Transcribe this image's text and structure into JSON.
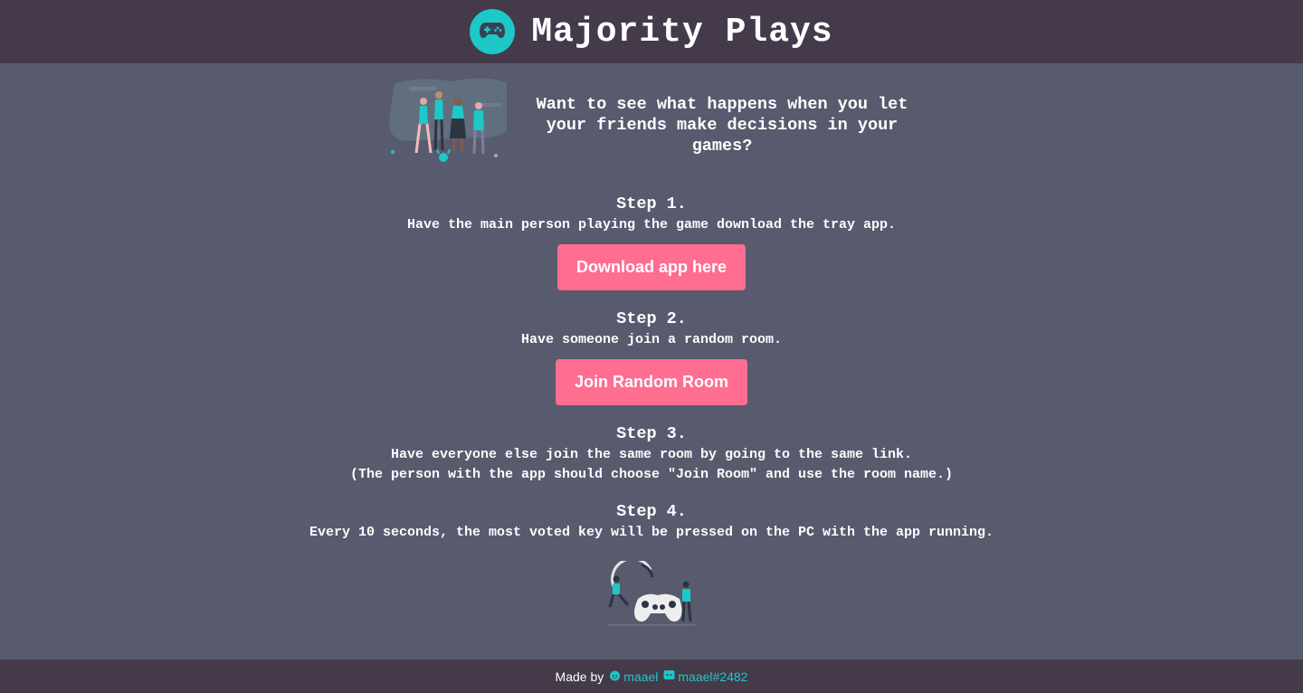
{
  "header": {
    "brand": "Majority Plays",
    "logo_icon": "gamepad-icon",
    "logo_color": "#1cc8c8"
  },
  "hero": {
    "tagline": "Want to see what happens when you let your friends make decisions in your games?"
  },
  "steps": [
    {
      "title": "Step 1.",
      "description": "Have the main person playing the game download the tray app.",
      "button": "Download app here"
    },
    {
      "title": "Step 2.",
      "description": "Have someone join a random room.",
      "button": "Join Random Room"
    },
    {
      "title": "Step 3.",
      "description": "Have everyone else join the same room by going to the same link.",
      "note": "(The person with the app should choose \"Join Room\" and use the room name.)"
    },
    {
      "title": "Step 4.",
      "description": "Every 10 seconds, the most voted key will be pressed on the PC with the app running."
    }
  ],
  "footer": {
    "made_by": "Made by",
    "reddit_handle": "maael",
    "reddit_icon": "reddit-icon",
    "discord_handle": "maael#2482",
    "discord_icon": "discord-icon"
  },
  "colors": {
    "background": "#575b6d",
    "bar": "#443a4a",
    "accent": "#1cc8c8",
    "button": "#ff6d91"
  }
}
